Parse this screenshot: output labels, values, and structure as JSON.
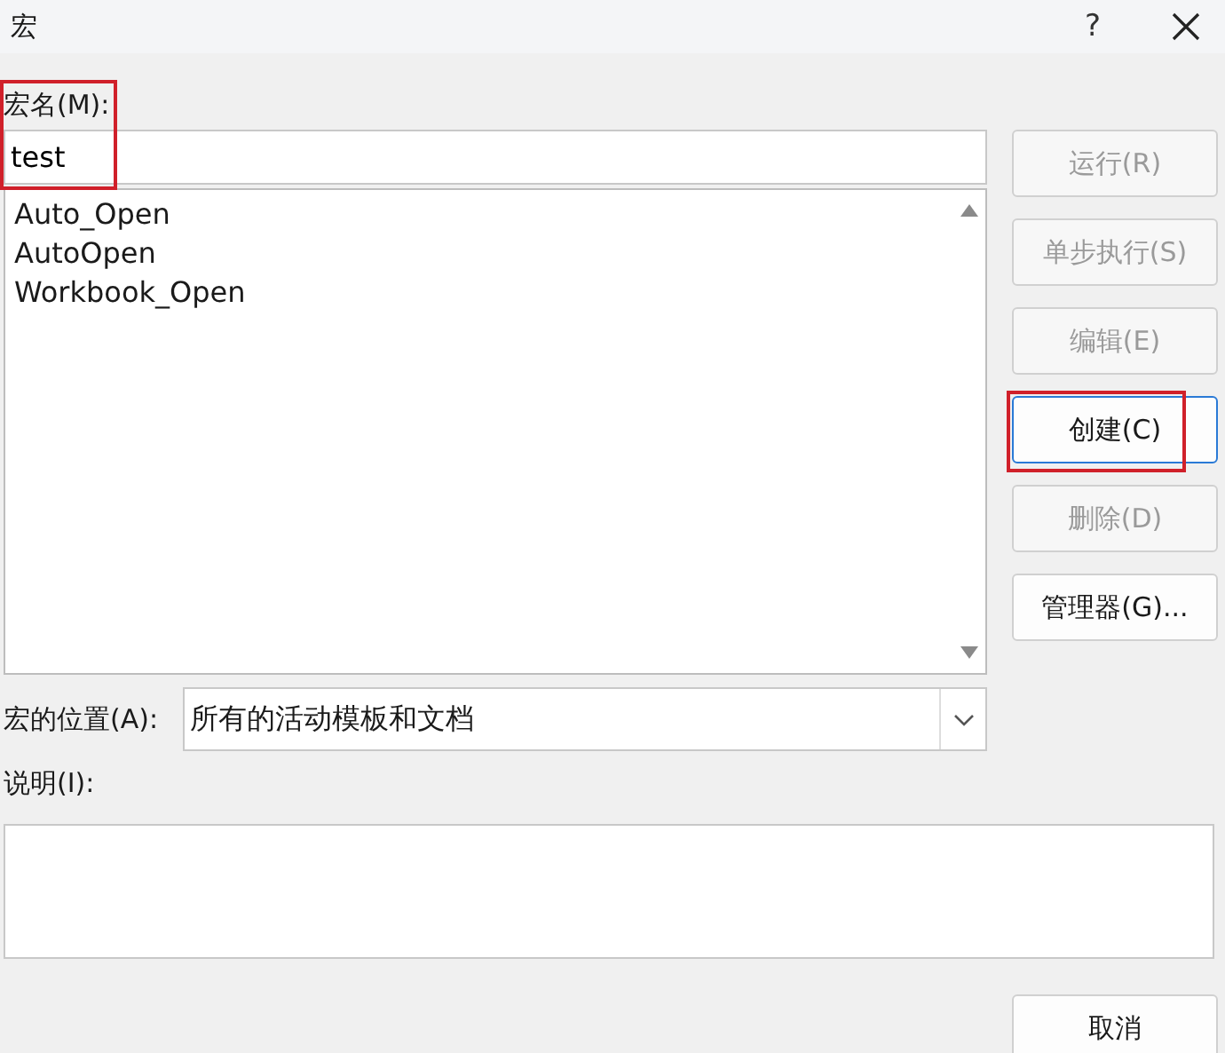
{
  "window": {
    "title": "宏",
    "help": "?"
  },
  "macro_name": {
    "label": "宏名(M):",
    "value": "test",
    "highlighted": true
  },
  "macro_list": [
    {
      "name": "Auto_Open",
      "selected": false
    },
    {
      "name": "AutoOpen",
      "selected": false
    },
    {
      "name": "Workbook_Open",
      "selected": false
    }
  ],
  "buttons": [
    {
      "label": "运行(R)",
      "disabled": true,
      "focused": false,
      "highlighted": false
    },
    {
      "label": "单步执行(S)",
      "disabled": true,
      "focused": false,
      "highlighted": false
    },
    {
      "label": "编辑(E)",
      "disabled": true,
      "focused": false,
      "highlighted": false
    },
    {
      "label": "创建(C)",
      "disabled": false,
      "focused": true,
      "highlighted": true
    },
    {
      "label": "删除(D)",
      "disabled": true,
      "focused": false,
      "highlighted": false
    },
    {
      "label": "管理器(G)...",
      "disabled": false,
      "focused": false,
      "highlighted": false
    }
  ],
  "location": {
    "label": "宏的位置(A):",
    "value": "所有的活动模板和文档"
  },
  "description": {
    "label": "说明(I):"
  },
  "cancel_button": {
    "label": "取消"
  }
}
